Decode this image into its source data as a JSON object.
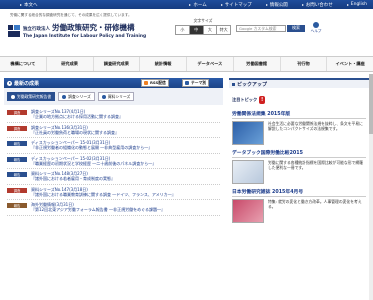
{
  "topbar": {
    "skip": "本文へ",
    "links": [
      "ホーム",
      "サイトマップ",
      "情報公開",
      "お問い合わせ",
      "English"
    ]
  },
  "header": {
    "tagline": "労働に関する総合的な調査研究を通じて、その成果を広く提供しています。",
    "org_prefix": "独立行政法人",
    "org_name": "労働政策研究・研修機構",
    "org_en": "The Japan Institute for Labour Policy and Training",
    "fontsize_label": "文字サイズ",
    "fontsize_options": [
      "小",
      "中",
      "大",
      "特大"
    ],
    "search_placeholder": "Google カスタム検索",
    "search_button": "検索",
    "help_label": "ヘルプ"
  },
  "nav": [
    "機構について",
    "研究成果",
    "調査研究成果",
    "統計情報",
    "データベース",
    "労働図書館",
    "刊行物",
    "イベント・講座"
  ],
  "results": {
    "title": "最新の成果",
    "rss_label": "RSS配信",
    "theme_label": "テーマ別",
    "tabs": [
      "労働政策研究報告書",
      "調査シリーズ",
      "資料シリーズ"
    ],
    "rows": [
      {
        "cat": "調査",
        "color": "red",
        "text": "調査シリーズNo.137(4月1日)",
        "sub": "『企業の地方拠点における採用活動に関する調査』"
      },
      {
        "cat": "調査",
        "color": "red",
        "text": "調査シリーズNo.136(3月31日)",
        "sub": "『正社員の労働負荷と職場の現状に関する調査』"
      },
      {
        "cat": "報告",
        "color": "blue",
        "text": "ディスカッションペーパー 15-01(3月31日)",
        "sub": "『非正規労働者の組織化の動態と展開 ―非典型雇用の調査から―』"
      },
      {
        "cat": "報告",
        "color": "blue",
        "text": "ディスカッションペーパー 15-02(3月31日)",
        "sub": "『職業経歴の初期状況と学校経歴 ―二十歳前後のパネル調査から―』"
      },
      {
        "cat": "報告",
        "color": "blue",
        "text": "資料シリーズNo.148(3月27日)",
        "sub": "『諸外国における若者雇用・育成制度の実態』"
      },
      {
        "cat": "調査",
        "color": "red",
        "text": "資料シリーズNo.147(3月18日)",
        "sub": "『諸外国における職業教育訓練に関する調査 ―ドイツ、フランス、アメリカ―』"
      },
      {
        "cat": "報告",
        "color": "brown",
        "text": "海外労働情報(3月31日)",
        "sub": "『第12回北東アジア労働フォーラム報告書 ―非正規労働をめぐる課題―』"
      }
    ]
  },
  "pickup": {
    "title": "ピックアップ",
    "sub": "注目トピック",
    "items": [
      {
        "title": "労働関係法規集 2015年版",
        "desc": "社会生活に必要な労働関係法規を抜粋し、条文を平易に解説したコンパクトサイズの法規集です。"
      },
      {
        "title": "データブック国際労働比較2015",
        "desc": "労働に関する各種統計指標を国際比較が可能な形で網羅した便利な一冊です。"
      },
      {
        "title": "日本労働研究雑誌 2015年4月号",
        "desc": "特集: 就労の変化と働き方改革。人事管理の変化を考える。"
      }
    ]
  },
  "colors": {
    "nav_blue": "#1f4d9c",
    "panel_blue": "#2a4f8f",
    "alert_red": "#d02020"
  }
}
